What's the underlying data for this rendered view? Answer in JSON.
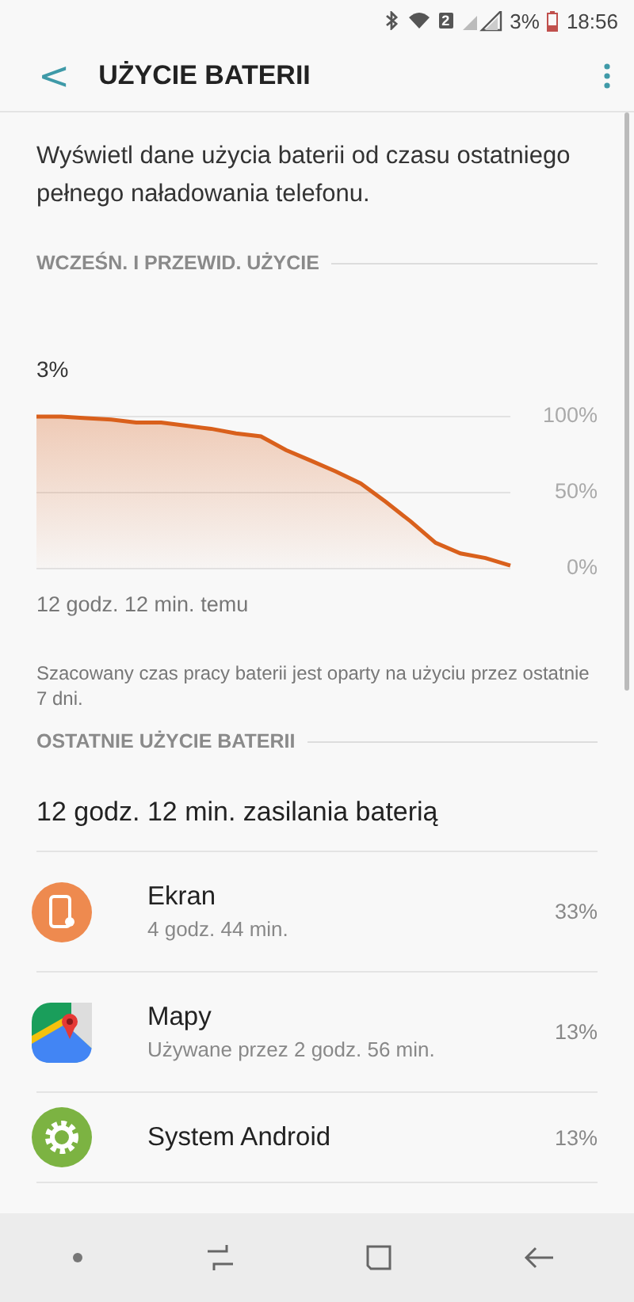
{
  "status_bar": {
    "sim_slot": "2",
    "battery_percent": "3%",
    "time": "18:56"
  },
  "header": {
    "back_icon": "<",
    "title": "UŻYCIE BATERII"
  },
  "intro": "Wyświetl dane użycia baterii od czasu ostatniego pełnego naładowania telefonu.",
  "usage_section": {
    "title": "WCZEŚN. I PRZEWID. UŻYCIE",
    "current_level": "3%",
    "chart_data": {
      "type": "area",
      "series": [
        {
          "color": "#d9601c",
          "values": [
            100,
            100,
            99,
            98,
            96,
            96,
            94,
            92,
            89,
            87,
            78,
            71,
            64,
            56,
            44,
            31,
            17,
            10,
            7,
            2
          ]
        }
      ],
      "ylim": [
        0,
        100
      ],
      "yticks": [
        {
          "value": 0,
          "label": "0%"
        },
        {
          "value": 50,
          "label": "50%"
        },
        {
          "value": 100,
          "label": "100%"
        }
      ]
    },
    "start_label": "12 godz. 12 min. temu",
    "note": "Szacowany czas pracy baterii jest oparty na użyciu przez ostatnie 7 dni."
  },
  "recent_section": {
    "title": "OSTATNIE UŻYCIE BATERII",
    "summary": "12 godz. 12 min. zasilania baterią",
    "items": [
      {
        "kind": "screen",
        "name": "Ekran",
        "detail": "4 godz. 44 min.",
        "percent": "33%",
        "color": "#ee8a4f"
      },
      {
        "kind": "maps",
        "name": "Mapy",
        "detail": "Używane przez 2 godz. 56 min.",
        "percent": "13%"
      },
      {
        "kind": "system",
        "name": "System Android",
        "percent": "13%",
        "color": "#7cb342"
      }
    ]
  }
}
